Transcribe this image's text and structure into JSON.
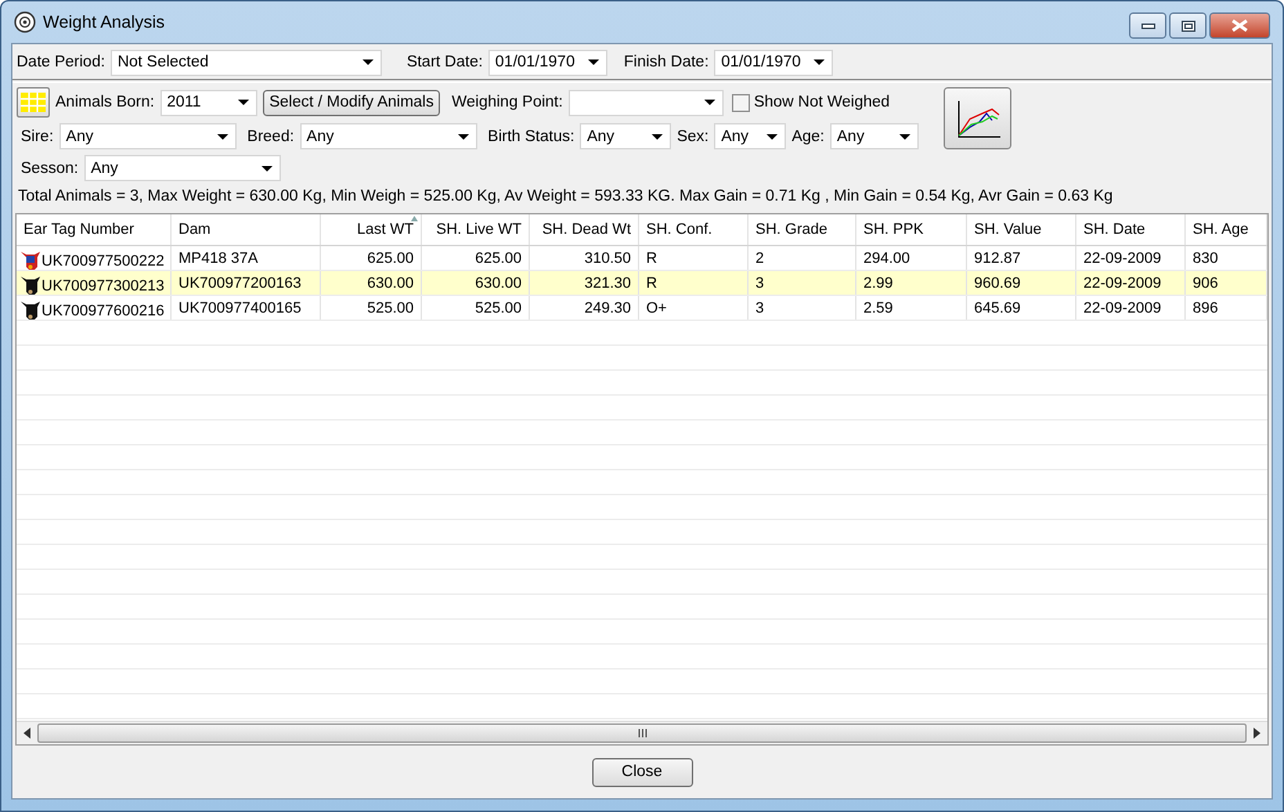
{
  "window": {
    "title": "Weight Analysis"
  },
  "filters_top": [
    {
      "label": "Date Period:",
      "value": "Not Selected"
    },
    {
      "label": "Start Date:",
      "value": "01/01/1970"
    },
    {
      "label": "Finish Date:",
      "value": "01/01/1970"
    }
  ],
  "animals_born": {
    "label": "Animals Born:",
    "value": "2011"
  },
  "select_button": "Select / Modify Animals",
  "weighing_point": {
    "label": "Weighing Point:"
  },
  "show_not_weighed": {
    "label": "Show Not Weighed",
    "checked": false
  },
  "filters_row2": [
    {
      "label": "Sire:",
      "value": "Any"
    },
    {
      "label": "Breed:",
      "value": "Any"
    },
    {
      "label": "Birth Status:",
      "value": "Any"
    },
    {
      "label": "Sex:",
      "value": "Any"
    },
    {
      "label": "Age:",
      "value": "Any"
    }
  ],
  "season": {
    "label": "Sesson:",
    "value": "Any"
  },
  "summary": "Total Animals = 3, Max Weight = 630.00 Kg, Min Weigh = 525.00 Kg, Av Weight = 593.33 KG. Max Gain = 0.71 Kg , Min Gain = 0.54 Kg, Avr Gain = 0.63 Kg",
  "table": {
    "columns": [
      {
        "label": "Ear Tag Number",
        "sorted": false
      },
      {
        "label": "Dam",
        "sorted": false
      },
      {
        "label": "Last WT",
        "sorted": true
      },
      {
        "label": "SH. Live WT",
        "sorted": false
      },
      {
        "label": "SH. Dead Wt",
        "sorted": false
      },
      {
        "label": "SH. Conf.",
        "sorted": false
      },
      {
        "label": "SH. Grade",
        "sorted": false
      },
      {
        "label": "SH. PPK",
        "sorted": false
      },
      {
        "label": "SH. Value",
        "sorted": false
      },
      {
        "label": "SH. Date",
        "sorted": false
      },
      {
        "label": "SH. Age",
        "sorted": false
      }
    ],
    "rows": [
      {
        "kind": "colored",
        "selected": false,
        "cells": [
          "UK700977500222",
          "MP418 37A",
          "625.00",
          "625.00",
          "310.50",
          "R",
          "2",
          "294.00",
          "912.87",
          "22-09-2009",
          "830"
        ]
      },
      {
        "kind": "black",
        "selected": true,
        "cells": [
          "UK700977300213",
          "UK700977200163",
          "630.00",
          "630.00",
          "321.30",
          "R",
          "3",
          "2.99",
          "960.69",
          "22-09-2009",
          "906"
        ]
      },
      {
        "kind": "black",
        "selected": false,
        "cells": [
          "UK700977600216",
          "UK700977400165",
          "525.00",
          "525.00",
          "249.30",
          "O+",
          "3",
          "2.59",
          "645.69",
          "22-09-2009",
          "896"
        ]
      }
    ]
  },
  "close_button": "Close"
}
